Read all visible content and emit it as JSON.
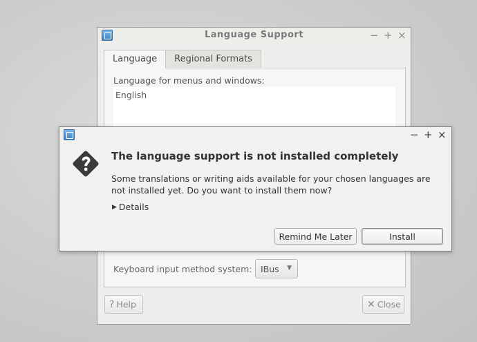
{
  "background_window": {
    "title": "Language Support",
    "controls": [
      "−",
      "+",
      "×"
    ],
    "tabs": [
      {
        "label": "Language",
        "active": true
      },
      {
        "label": "Regional Formats",
        "active": false
      }
    ],
    "menus_label": "Language for menus and windows:",
    "languages": [
      "English"
    ],
    "keyboard_label": "Keyboard input method system:",
    "keyboard_value": "IBus",
    "help_icon": "?",
    "help_label": "Help",
    "close_icon": "✕",
    "close_label": "Close"
  },
  "dialog": {
    "controls": [
      "−",
      "+",
      "×"
    ],
    "icon": "question-icon",
    "heading": "The language support is not installed completely",
    "message": "Some translations or writing aids available for your chosen languages are not installed yet. Do you want to install them now?",
    "details_label": "Details",
    "remind_label": "Remind Me Later",
    "install_label": "Install"
  }
}
